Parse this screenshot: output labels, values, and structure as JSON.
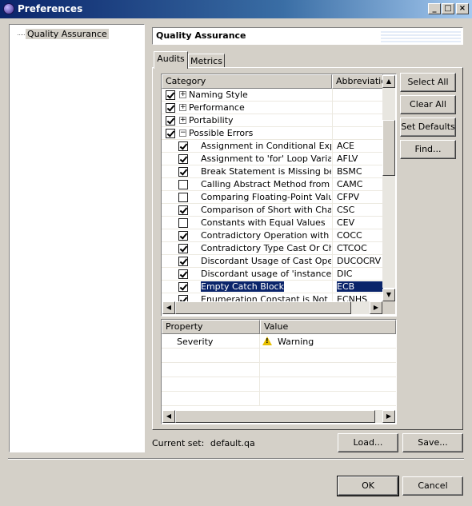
{
  "window": {
    "title": "Preferences",
    "controls": [
      "_",
      "□",
      "×"
    ]
  },
  "tree": {
    "items": [
      {
        "label": "Quality Assurance"
      }
    ]
  },
  "page": {
    "title": "Quality Assurance"
  },
  "tabs": [
    {
      "label": "Audits",
      "selected": true
    },
    {
      "label": "Metrics",
      "selected": false
    }
  ],
  "audits_table": {
    "headers": {
      "category": "Category",
      "abbreviation": "Abbreviation"
    },
    "rows": [
      {
        "name": "Naming Style",
        "abbr": "",
        "checked": true,
        "group": true,
        "expanded": false
      },
      {
        "name": "Performance",
        "abbr": "",
        "checked": true,
        "group": true,
        "expanded": false
      },
      {
        "name": "Portability",
        "abbr": "",
        "checked": true,
        "group": true,
        "expanded": false
      },
      {
        "name": "Possible Errors",
        "abbr": "",
        "checked": true,
        "group": true,
        "expanded": true
      },
      {
        "name": "Assignment in Conditional Expr...",
        "abbr": "ACE",
        "checked": true
      },
      {
        "name": "Assignment to 'for' Loop Variable",
        "abbr": "AFLV",
        "checked": true
      },
      {
        "name": "Break Statement is Missing bef...",
        "abbr": "BSMC",
        "checked": true
      },
      {
        "name": "Calling Abstract Method from C...",
        "abbr": "CAMC",
        "checked": false
      },
      {
        "name": "Comparing Floating-Point Values",
        "abbr": "CFPV",
        "checked": false
      },
      {
        "name": "Comparison of Short with Char",
        "abbr": "CSC",
        "checked": true
      },
      {
        "name": "Constants with Equal Values",
        "abbr": "CEV",
        "checked": false
      },
      {
        "name": "Contradictory Operation with ...",
        "abbr": "COCC",
        "checked": true
      },
      {
        "name": "Contradictory Type Cast Or Ch...",
        "abbr": "CTCOC",
        "checked": true
      },
      {
        "name": "Discordant Usage of Cast Oper...",
        "abbr": "DUCOCRV",
        "checked": true
      },
      {
        "name": "Discordant usage of 'instanceo...",
        "abbr": "DIC",
        "checked": true
      },
      {
        "name": "Empty Catch Block",
        "abbr": "ECB",
        "checked": true,
        "selected": true
      },
      {
        "name": "Enumeration Constant is Not H...",
        "abbr": "ECNHS",
        "checked": true
      }
    ]
  },
  "side_buttons": {
    "select_all": "Select All",
    "clear_all": "Clear All",
    "set_defaults": "Set Defaults",
    "find": "Find..."
  },
  "property_table": {
    "headers": {
      "property": "Property",
      "value": "Value"
    },
    "rows": [
      {
        "property": "Severity",
        "value": "Warning",
        "icon": "warning-icon"
      }
    ]
  },
  "current_set": {
    "label": "Current set:",
    "value": "default.qa"
  },
  "buttons": {
    "load": "Load...",
    "save": "Save...",
    "ok": "OK",
    "cancel": "Cancel"
  }
}
